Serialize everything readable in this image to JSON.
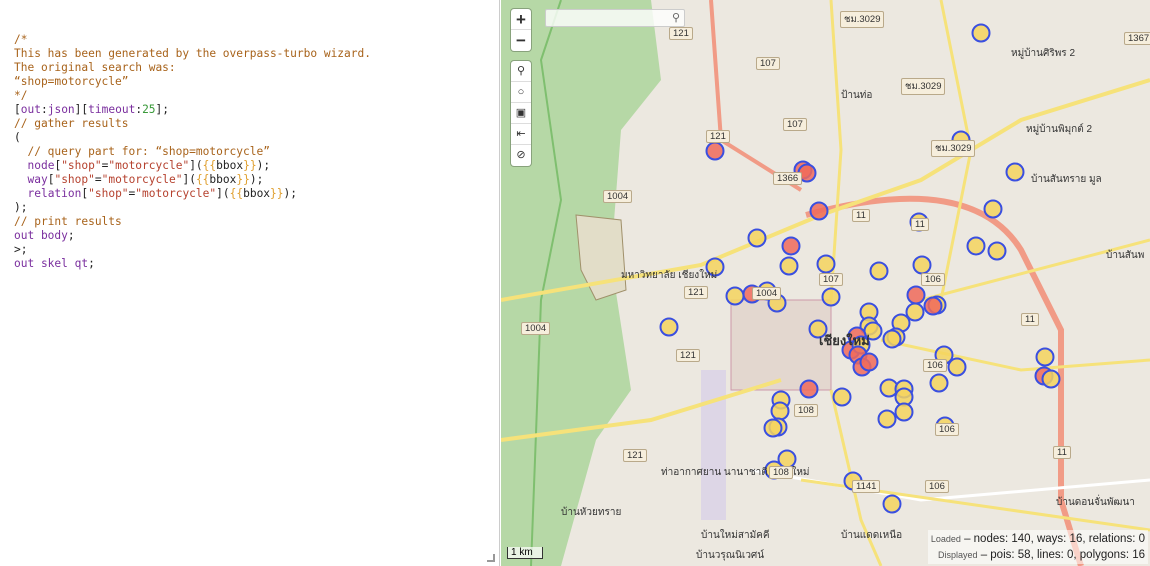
{
  "editor": {
    "lines": [
      [
        [
          "c",
          "/*"
        ]
      ],
      [
        [
          "c",
          "This has been generated by the overpass-turbo wizard."
        ]
      ],
      [
        [
          "c",
          "The original search was:"
        ]
      ],
      [
        [
          "c",
          "“shop=motorcycle”"
        ]
      ],
      [
        [
          "c",
          "*/"
        ]
      ],
      [
        [
          "",
          "["
        ],
        [
          "k",
          "out"
        ],
        [
          "",
          ":"
        ],
        [
          "k",
          "json"
        ],
        [
          "",
          "]["
        ],
        [
          "k",
          "timeout"
        ],
        [
          "",
          ":"
        ],
        [
          "n",
          "25"
        ],
        [
          "",
          "];"
        ]
      ],
      [
        [
          "c",
          "// gather results"
        ]
      ],
      [
        [
          "",
          "("
        ]
      ],
      [
        [
          "c",
          "  // query part for: “shop=motorcycle”"
        ]
      ],
      [
        [
          "",
          "  "
        ],
        [
          "k",
          "node"
        ],
        [
          "",
          "["
        ],
        [
          "s",
          "\"shop\""
        ],
        [
          "",
          "="
        ],
        [
          "s",
          "\"motorcycle\""
        ],
        [
          "",
          "]("
        ],
        [
          "b",
          "{{"
        ],
        [
          "",
          "bbox"
        ],
        [
          "b",
          "}}"
        ],
        [
          "",
          ");"
        ]
      ],
      [
        [
          "",
          "  "
        ],
        [
          "k",
          "way"
        ],
        [
          "",
          "["
        ],
        [
          "s",
          "\"shop\""
        ],
        [
          "",
          "="
        ],
        [
          "s",
          "\"motorcycle\""
        ],
        [
          "",
          "]("
        ],
        [
          "b",
          "{{"
        ],
        [
          "",
          "bbox"
        ],
        [
          "b",
          "}}"
        ],
        [
          "",
          ");"
        ]
      ],
      [
        [
          "",
          "  "
        ],
        [
          "k",
          "relation"
        ],
        [
          "",
          "["
        ],
        [
          "s",
          "\"shop\""
        ],
        [
          "",
          "="
        ],
        [
          "s",
          "\"motorcycle\""
        ],
        [
          "",
          "]("
        ],
        [
          "b",
          "{{"
        ],
        [
          "",
          "bbox"
        ],
        [
          "b",
          "}}"
        ],
        [
          "",
          ");"
        ]
      ],
      [
        [
          "",
          ");"
        ]
      ],
      [
        [
          "c",
          "// print results"
        ]
      ],
      [
        [
          "k",
          "out body"
        ],
        [
          "",
          ";"
        ]
      ],
      [
        [
          "",
          ">;"
        ]
      ],
      [
        [
          "k",
          "out skel qt"
        ],
        [
          "",
          ";"
        ]
      ]
    ]
  },
  "map": {
    "zoom_in": "+",
    "zoom_out": "−",
    "tools": [
      {
        "icon": "search-icon",
        "glyph": "⚲"
      },
      {
        "icon": "circle-icon",
        "glyph": "○"
      },
      {
        "icon": "image-icon",
        "glyph": "▣"
      },
      {
        "icon": "fit-data-icon",
        "glyph": "⇤"
      },
      {
        "icon": "disable-icon",
        "glyph": "⊘"
      }
    ],
    "search_icon": "⚲",
    "scale": "1 km",
    "labels": [
      "หมู่บ้านศิริพร 2",
      "ป้านท่อ",
      "หมู่บ้านพิมุกต์ 2",
      "บ้านสันทราย มูล",
      "มหาวิทยาลัย เชียงใหม่",
      "เชียงใหม่",
      "บ้านหัวยทราย",
      "ท่าอากาศยาน นานาชาติ เชียงใหม่",
      "บ้านใหม่สามัคคี",
      "บ้านแดดเหนือ",
      "บ้านวรุณนิเวศน์",
      "บ้านดอนจั่นพัฒนา",
      "บ้านสันพ"
    ],
    "shields": [
      "121",
      "107",
      "ชม.3029",
      "ชม.3029",
      "1367",
      "121",
      "107",
      "ชม.3029",
      "1366",
      "1004",
      "11",
      "11",
      "121",
      "107",
      "1004",
      "106",
      "1004",
      "121",
      "11",
      "106",
      "108",
      "121",
      "108",
      "106",
      "1141",
      "106",
      "11"
    ],
    "marker_colors": {
      "stroke": "#3a4fe0",
      "fill": "#f4d35e",
      "fill_red": "#f06a5a"
    }
  },
  "status": {
    "loaded_label": "Loaded",
    "loaded": " – nodes: 140, ways: 16, relations: 0",
    "displayed_label": "Displayed",
    "displayed": " – pois: 58, lines: 0, polygons: 16"
  }
}
